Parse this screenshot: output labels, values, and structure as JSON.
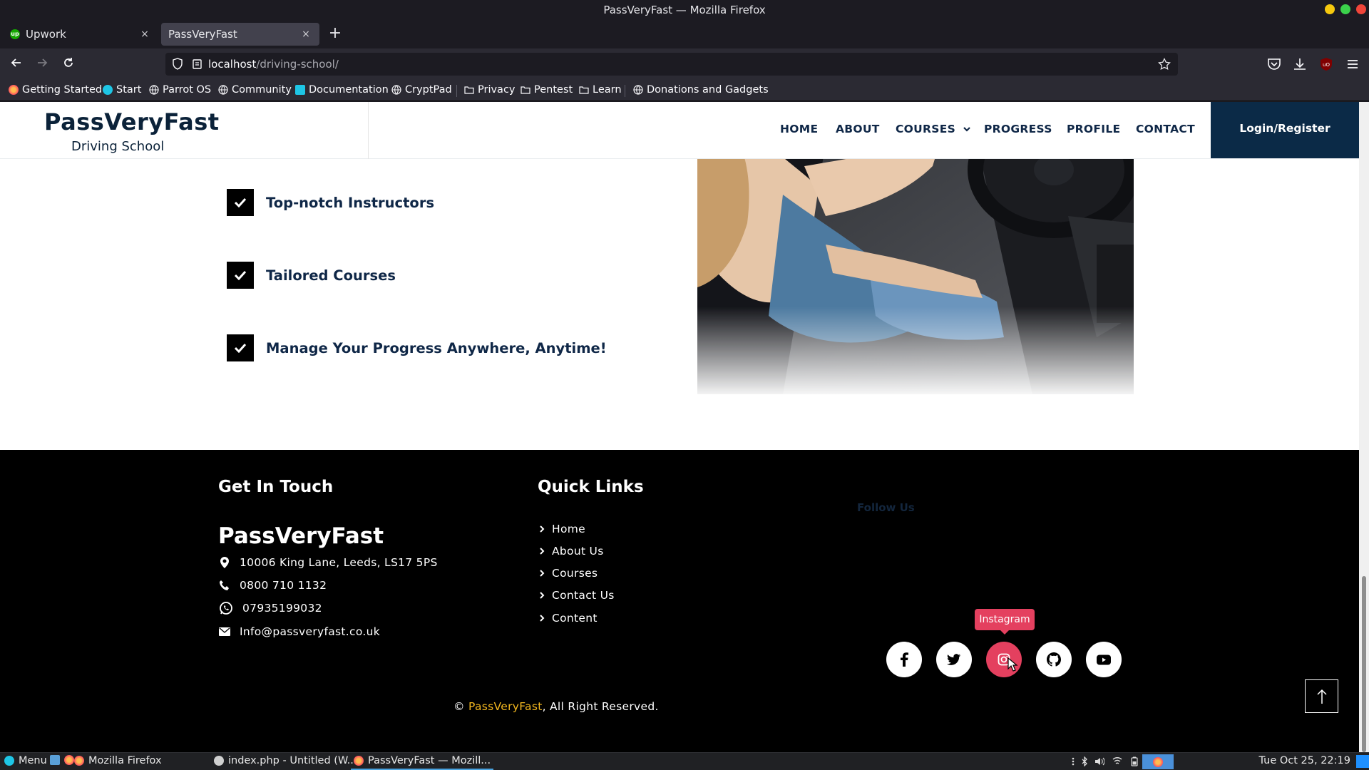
{
  "window": {
    "title": "PassVeryFast — Mozilla Firefox"
  },
  "tabs": [
    {
      "label": "Upwork",
      "close": "×"
    },
    {
      "label": "PassVeryFast",
      "close": "×"
    }
  ],
  "newtab": "+",
  "address": {
    "host": "localhost",
    "path": "/driving-school/"
  },
  "bookmarks": [
    "Getting Started",
    "Start",
    "Parrot OS",
    "Community",
    "Documentation",
    "CryptPad",
    "Privacy",
    "Pentest",
    "Learn",
    "Donations and Gadgets"
  ],
  "site": {
    "brand": "PassVeryFast",
    "brand_sub": "Driving School",
    "nav": [
      "HOME",
      "ABOUT",
      "COURSES",
      "PROGRESS",
      "PROFILE",
      "CONTACT"
    ],
    "login": "Login/Register",
    "features": [
      "Top-notch Instructors",
      "Tailored Courses",
      "Manage Your Progress Anywhere, Anytime!"
    ]
  },
  "footer": {
    "get_in_touch": "Get In Touch",
    "brand": "PassVeryFast",
    "address": "10006 King Lane, Leeds, LS17 5PS",
    "phone": "0800 710 1132",
    "whatsapp": "07935199032",
    "email": "Info@passveryfast.co.uk",
    "quick_links_title": "Quick Links",
    "quick_links": [
      "Home",
      "About Us",
      "Courses",
      "Contact Us",
      "Content"
    ],
    "follow_us": "Follow Us",
    "tooltip": "Instagram",
    "social": [
      "facebook-icon",
      "twitter-icon",
      "instagram-icon",
      "github-icon",
      "youtube-icon"
    ],
    "copyright_symbol": "©",
    "copyright_brand": "PassVeryFast",
    "copyright_rest": ", All Right Reserved."
  },
  "taskbar": {
    "menu": "Menu",
    "items": [
      "Mozilla Firefox",
      "index.php - Untitled (W...",
      "PassVeryFast — Mozill..."
    ],
    "clock": "Tue Oct 25, 22:19"
  },
  "colors": {
    "navy": "#0b2a47",
    "instagram": "#e4405f",
    "brand_link": "#f4b81f"
  }
}
